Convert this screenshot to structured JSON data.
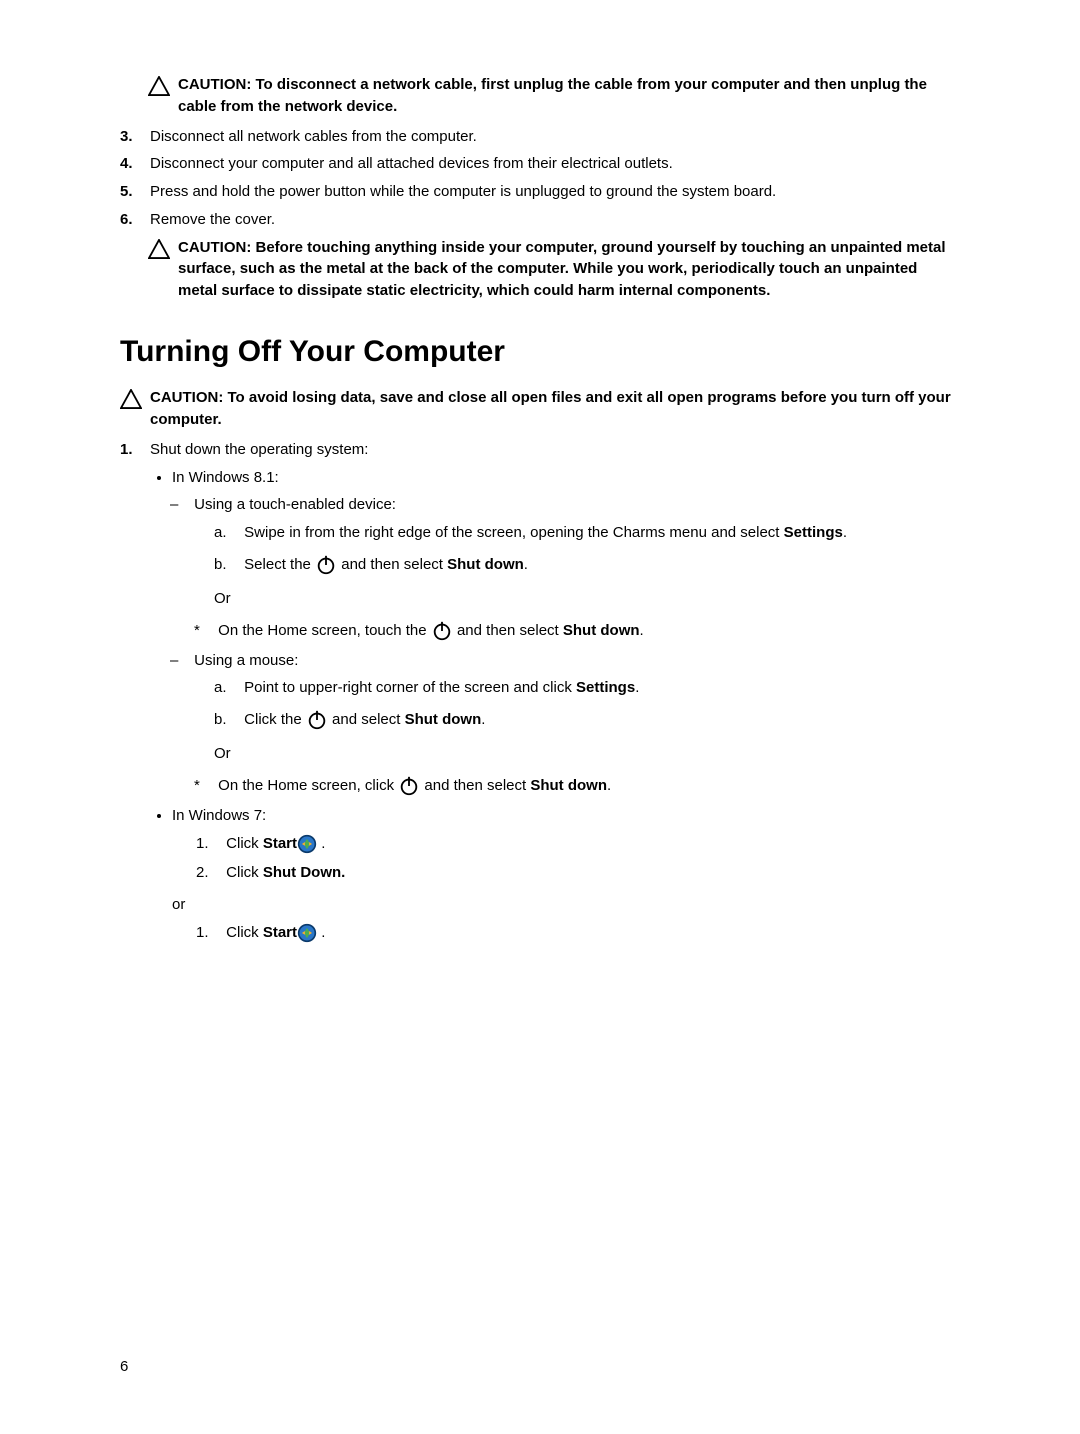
{
  "caution1": "CAUTION: To disconnect a network cable, first unplug the cable from your computer and then unplug the cable from the network device.",
  "steps": {
    "s3": {
      "num": "3.",
      "text": "Disconnect all network cables from the computer."
    },
    "s4": {
      "num": "4.",
      "text": "Disconnect your computer and all attached devices from their electrical outlets."
    },
    "s5": {
      "num": "5.",
      "text": "Press and hold the power button while the computer is unplugged to ground the system board."
    },
    "s6": {
      "num": "6.",
      "text": "Remove the cover."
    }
  },
  "caution2": "CAUTION: Before touching anything inside your computer, ground yourself by touching an unpainted metal surface, such as the metal at the back of the computer. While you work, periodically touch an unpainted metal surface to dissipate static electricity, which could harm internal components.",
  "section_title": "Turning Off Your Computer",
  "caution3": "CAUTION: To avoid losing data, save and close all open files and exit all open programs before you turn off your computer.",
  "shutdown": {
    "num": "1.",
    "intro": "Shut down the operating system:",
    "win81": "In Windows 8.1:",
    "touch_device": "Using a touch-enabled device:",
    "touch_a": {
      "lbl": "a.",
      "pre": "Swipe in from the right edge of the screen, opening the Charms menu and select ",
      "bold": "Settings",
      "post": "."
    },
    "touch_b": {
      "lbl": "b.",
      "pre": "Select the ",
      "post1": " and then select ",
      "bold": "Shut down",
      "post2": "."
    },
    "or": "Or",
    "touch_star": {
      "pre": "On the Home screen, touch the ",
      "post1": " and then select ",
      "bold": "Shut down",
      "post2": "."
    },
    "mouse": "Using a mouse:",
    "mouse_a": {
      "lbl": "a.",
      "text": "Point to upper-right corner of the screen and click ",
      "bold": "Settings",
      "post": "."
    },
    "mouse_b": {
      "lbl": "b.",
      "pre": "Click the ",
      "post1": " and select ",
      "bold": "Shut down",
      "post2": "."
    },
    "mouse_star": {
      "pre": "On the Home screen, click ",
      "post1": " and then select ",
      "bold": "Shut down",
      "post2": "."
    },
    "win7": "In Windows 7:",
    "win7_1": {
      "lbl": "1.",
      "pre": "Click ",
      "bold": "Start",
      "post": " ."
    },
    "win7_2": {
      "lbl": "2.",
      "pre": "Click ",
      "bold": "Shut Down."
    },
    "or_lower": "or",
    "win7_1b": {
      "lbl": "1.",
      "pre": "Click ",
      "bold": "Start",
      "post": " ."
    }
  },
  "page_number": "6"
}
